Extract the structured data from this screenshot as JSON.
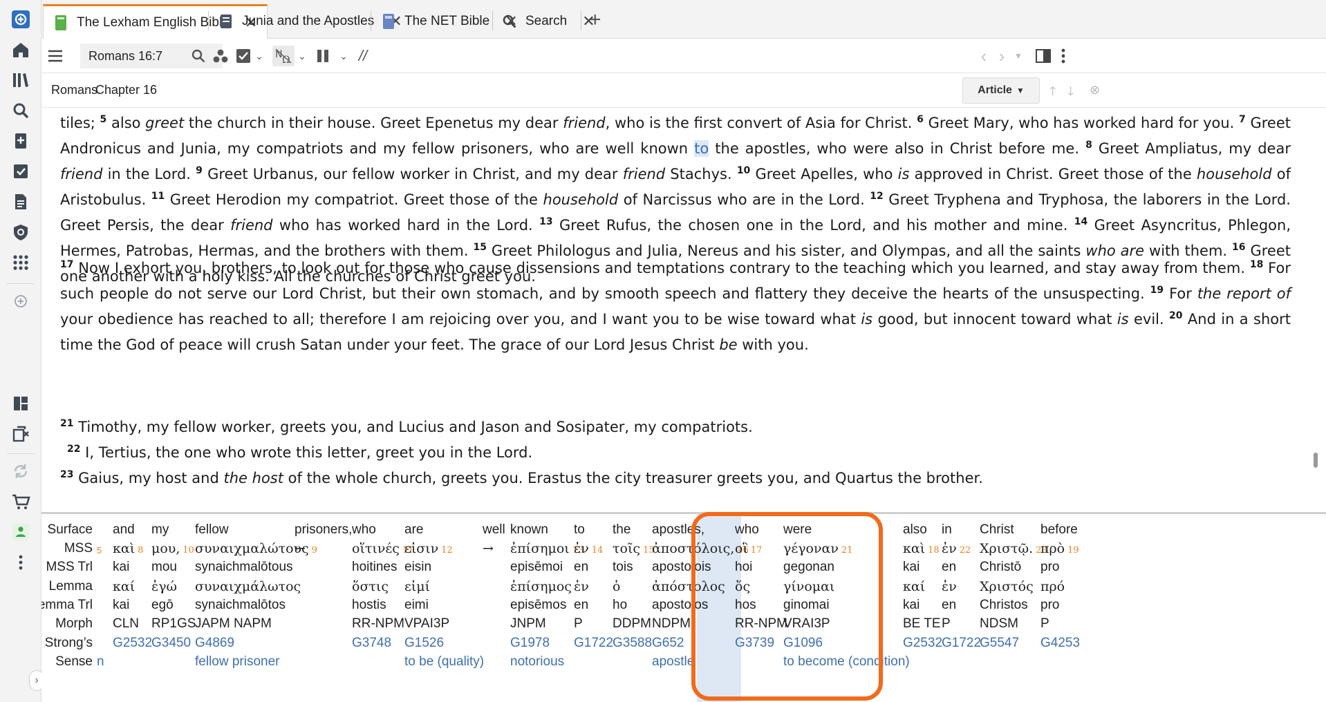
{
  "sidebar": {
    "icons": [
      "logos-app-icon",
      "home-icon",
      "library-icon",
      "search-icon",
      "bookmark-add-icon",
      "checklist-icon",
      "document-icon",
      "shield-icon",
      "apps-grid-icon",
      "add-icon",
      "layout-icon",
      "copy-close-icon",
      "sync-icon",
      "cart-icon",
      "user-status-icon",
      "more-icon",
      "expand-chevron-icon"
    ]
  },
  "tabs": [
    {
      "label": "The Lexham English Bible",
      "icon": "book-green-icon"
    },
    {
      "label": "Junia and the Apostles",
      "icon": "book-dark-icon"
    },
    {
      "label": "The NET Bible",
      "icon": "book-blue-icon"
    },
    {
      "label": "Search",
      "icon": "search-icon"
    }
  ],
  "toolbar": {
    "reference": "Romans 16:7",
    "sync_glyph": "//"
  },
  "breadcrumb": {
    "book": "Romans",
    "separator": "›",
    "chapter": "Chapter 16",
    "article_label": "Article"
  },
  "text": {
    "p1": {
      "v4_tail": "tiles;",
      "v5n": "5",
      "v5a": " also ",
      "v5i": "greet",
      "v5b": " the church in their house. Greet Epenetus my dear ",
      "v5i2": "friend",
      "v5c": ", who is the first convert of Asia for Christ.",
      "v6n": "6",
      "v6": " Greet Mary, who has worked hard for you.",
      "v7n": "7",
      "v7a": " Greet Andronicus and Junia, my compatriots and my fellow prisoners, who are well known ",
      "v7hl": "to",
      "v7b": " the apostles, who were also in Christ before me.",
      "v8n": "8",
      "v8a": " Greet Ampliatus, my dear ",
      "v8i": "friend",
      "v8b": " in the Lord.",
      "v9n": "9",
      "v9a": " Greet Urbanus, our fellow worker in Christ, and my dear ",
      "v9i": "friend",
      "v9b": " Stachys.",
      "v10n": "10",
      "v10a": " Greet Apelles, who ",
      "v10i": "is",
      "v10b": " approved in Christ. Greet those of the ",
      "v10i2": "household",
      "v10c": " of Aristobulus.",
      "v11n": "11",
      "v11a": " Greet Herodion my compatriot. Greet those of the ",
      "v11i": "household",
      "v11b": " of Narcissus who are in the Lord.",
      "v12n": "12",
      "v12a": " Greet Tryphena and Tryphosa, the laborers in the Lord. Greet Persis, the dear ",
      "v12i": "friend",
      "v12b": " who has worked hard in the Lord.",
      "v13n": "13",
      "v13": " Greet Rufus, the chosen one in the Lord, and his mother and mine.",
      "v14n": "14",
      "v14": " Greet Asyncritus, Phlegon, Hermes, Patrobas, Hermas, and the brothers with them.",
      "v15n": "15",
      "v15a": " Greet Philologus and Julia, Nereus and his sister, and Olympas, and all the saints ",
      "v15i": "who are",
      "v15b": " with them.",
      "v16n": "16",
      "v16": " Greet one another with a holy kiss. All the churches of Christ greet you."
    },
    "p2": {
      "v17n": "17",
      "v17": " Now I exhort you, brothers, to look out for those who cause dissensions and temptations contrary to the teaching which you learned, and stay away from them.",
      "v18n": "18",
      "v18a": " For such people do not serve our Lord Christ, but their own stomach, and by smooth speech and flattery they deceive the hearts of the unsuspecting.",
      "v19n": "19",
      "v19a": " For ",
      "v19i": "the report of",
      "v19b": " your obedience has reached to all; therefore I am rejoicing over you, and I want you to be wise toward what ",
      "v19i2": "is",
      "v19c": " good, but innocent toward what ",
      "v19i3": "is",
      "v19d": " evil.",
      "v20n": "20",
      "v20a": " And in a short time the God of peace will crush Satan under your feet. The grace of our Lord Jesus Christ ",
      "v20i": "be",
      "v20b": " with you."
    },
    "p3": {
      "v21n": "21",
      "v21": " Timothy, my fellow worker, greets you, and Lucius and Jason and Sosipater, my compatriots.",
      "v22n": "22",
      "v22": " I, Tertius, the one who wrote this letter, greet you in the Lord.",
      "v23n": "23",
      "v23a": " Gaius, my host and ",
      "v23i": "the host",
      "v23b": " of the whole church, greets you. Erastus the city treasurer greets you, and Quartus the brother."
    }
  },
  "interlinear": {
    "row_labels": [
      "Surface",
      "MSS",
      "MSS Trl",
      "Lemma",
      "Lemma Trl",
      "Morph",
      "Strong’s",
      "Sense"
    ],
    "columns": [
      {
        "surface": "and",
        "mss": "καὶ",
        "mss_n": "8",
        "mss_trl": "kai",
        "lemma": "καί",
        "lemma_trl": "kai",
        "morph": "CLN",
        "strongs": "G2532",
        "sense": ""
      },
      {
        "surface": "my",
        "mss": "μου,",
        "mss_n": "10",
        "mss_trl": "mou",
        "lemma": "ἐγώ",
        "lemma_trl": "egō",
        "morph": "RP1GS",
        "strongs": "G3450",
        "sense": ""
      },
      {
        "surface": "fellow",
        "mss": "συναιχμαλώτους",
        "mss_n": "9",
        "mss_trl": "synaichmalōtous",
        "lemma": "συναιχμάλωτος",
        "lemma_trl": "synaichmalōtos",
        "morph": "JAPM NAPM",
        "strongs": "G4869",
        "sense": "fellow prisoner"
      },
      {
        "surface": "prisoners,",
        "mss": "←",
        "mss_n": "",
        "mss_trl": "",
        "lemma": "",
        "lemma_trl": "",
        "morph": "",
        "strongs": "",
        "sense": ""
      },
      {
        "surface": "who",
        "mss": "οἵτινές",
        "mss_n": "11",
        "mss_trl": "hoitines",
        "lemma": "ὅστις",
        "lemma_trl": "hostis",
        "morph": "RR-NPM",
        "strongs": "G3748",
        "sense": ""
      },
      {
        "surface": "are",
        "mss": "εἰσιν",
        "mss_n": "12",
        "mss_trl": "eisin",
        "lemma": "εἰμί",
        "lemma_trl": "eimi",
        "morph": "VPAI3P",
        "strongs": "G1526",
        "sense": "to be (quality)"
      },
      {
        "surface": "well",
        "mss": "→",
        "mss_n": "",
        "mss_trl": "",
        "lemma": "",
        "lemma_trl": "",
        "morph": "",
        "strongs": "",
        "sense": ""
      },
      {
        "surface": "known",
        "mss": "ἐπίσημοι",
        "mss_n": "13",
        "mss_trl": "episēmoi",
        "lemma": "ἐπίσημος",
        "lemma_trl": "episēmos",
        "morph": "JNPM",
        "strongs": "G1978",
        "sense": "notorious"
      },
      {
        "surface": "to",
        "mss": "ἐν",
        "mss_n": "14",
        "mss_trl": "en",
        "lemma": "ἐν",
        "lemma_trl": "en",
        "morph": "P",
        "strongs": "G1722",
        "sense": ""
      },
      {
        "surface": "the",
        "mss": "τοῖς",
        "mss_n": "15",
        "mss_trl": "tois",
        "lemma": "ὁ",
        "lemma_trl": "ho",
        "morph": "DDPM",
        "strongs": "G3588",
        "sense": ""
      },
      {
        "surface": "apostles,",
        "mss": "ἀποστόλοις,",
        "mss_n": "16",
        "mss_trl": "apostolois",
        "lemma": "ἀπόστολος",
        "lemma_trl": "apostolos",
        "morph": "NDPM",
        "strongs": "G652",
        "sense": "apostle"
      },
      {
        "surface": "who",
        "mss": "οἳ",
        "mss_n": "17",
        "mss_trl": "hoi",
        "lemma": "ὅς",
        "lemma_trl": "hos",
        "morph": "RR-NPM",
        "strongs": "G3739",
        "sense": ""
      },
      {
        "surface": "were",
        "mss": "γέγοναν",
        "mss_n": "21",
        "mss_trl": "gegonan",
        "lemma": "γίνομαι",
        "lemma_trl": "ginomai",
        "morph": "VRAI3P",
        "strongs": "G1096",
        "sense": "to become (condition)"
      },
      {
        "surface": "also",
        "mss": "καὶ",
        "mss_n": "18",
        "mss_trl": "kai",
        "lemma": "καί",
        "lemma_trl": "kai",
        "morph": "BE TE",
        "strongs": "G2532",
        "sense": ""
      },
      {
        "surface": "in",
        "mss": "ἐν",
        "mss_n": "22",
        "mss_trl": "en",
        "lemma": "ἐν",
        "lemma_trl": "en",
        "morph": "P",
        "strongs": "G1722",
        "sense": ""
      },
      {
        "surface": "Christ",
        "mss": "Χριστῷ.",
        "mss_n": "23",
        "mss_trl": "Christō",
        "lemma": "Χριστός",
        "lemma_trl": "Christos",
        "morph": "NDSM",
        "strongs": "G5547",
        "sense": ""
      },
      {
        "surface": "before",
        "mss": "πρὸ",
        "mss_n": "19",
        "mss_trl": "pro",
        "lemma": "πρό",
        "lemma_trl": "pro",
        "morph": "P",
        "strongs": "G4253",
        "sense": ""
      }
    ],
    "mss_leading_num": "5",
    "sense_leading": "n",
    "selected_column": 8,
    "callout_color": "#f26a1b",
    "link_color": "#3f6fb0",
    "accent_color": "#e8821e"
  }
}
